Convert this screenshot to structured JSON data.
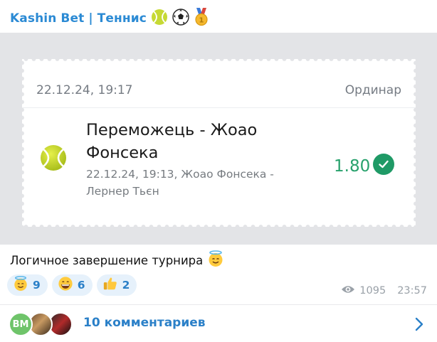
{
  "channel": {
    "name": "Kashin Bet | Теннис",
    "title_emojis": [
      "tennis-ball-icon",
      "soccer-ball-icon",
      "gold-medal-icon"
    ]
  },
  "ticket": {
    "date": "22.12.24, 19:17",
    "bet_type": "Ординар",
    "bet_title": "Переможець - Жоао Фонсека",
    "event_details": "22.12.24, 19:13, Жоао Фонсека - Лернер Тьєн",
    "odds": "1.80",
    "status_icon": "check-circle-icon",
    "colors": {
      "odds": "#27a16c",
      "status": "#1f9a66"
    }
  },
  "post": {
    "caption": "Логичное завершение турнира",
    "caption_emoji": "halo-face-icon",
    "views": "1095",
    "time": "23:57"
  },
  "reactions": [
    {
      "icon": "halo-face-icon",
      "count": "9"
    },
    {
      "icon": "grinning-face-icon",
      "count": "6"
    },
    {
      "icon": "thumbs-up-icon",
      "count": "2"
    }
  ],
  "comments": {
    "label": "10 комментариев",
    "first_avatar_initials": "BM"
  },
  "colors": {
    "accent": "#2b80c8",
    "reaction_bg": "#e6f1fb"
  }
}
